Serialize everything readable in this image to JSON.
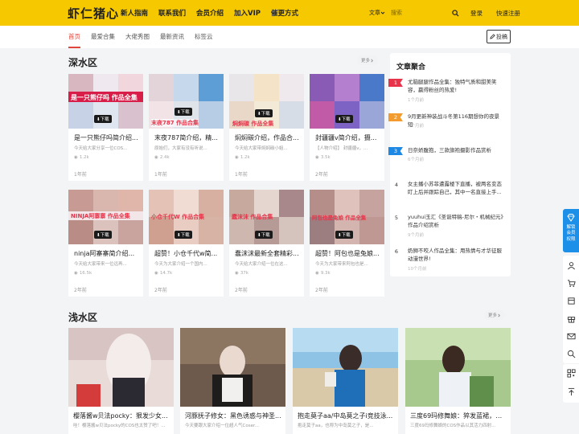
{
  "header": {
    "logo": "虾仁猪心",
    "nav": [
      "新人指南",
      "联系我们",
      "会员介绍",
      "加入VIP",
      "催更方式"
    ],
    "search_type": "文章",
    "search_placeholder": "搜索",
    "login": "登录",
    "register": "快速注册",
    "bar_color": "#f5c800"
  },
  "subnav": {
    "tabs": [
      "首页",
      "最爱合集",
      "大佬秀图",
      "最新资讯",
      "标签云"
    ],
    "active_tab": "首页",
    "post_button": "投稿",
    "accent_color": "#e0463b"
  },
  "deep_section": {
    "title": "深水区",
    "more": "更多",
    "badge_label": "下载",
    "cards": [
      {
        "title": "是一只熊仔吗简介绍...",
        "desc": "今天给大家分享一位COS...",
        "views": "1.2k",
        "time": "1年前",
        "overlay": "是一只熊仔吗 作品全集"
      },
      {
        "title": "末夜787简介绍，精...",
        "desc": "原始们，大家有没有听说...",
        "views": "2.4k",
        "time": "1年前",
        "overlay": "末夜787 作品合集"
      },
      {
        "title": "焖焖碳介绍，作品合...",
        "desc": "今天给大家带焖焖碳小姐...",
        "views": "1.2k",
        "time": "1年前",
        "overlay": "焖焖碳 作品全集"
      },
      {
        "title": "封疆疆v简介绍，摄...",
        "desc": "【人物介绍】 封疆疆v，...",
        "views": "3.5k",
        "time": "2年前",
        "overlay": ""
      },
      {
        "title": "ninja阿寨寨简介绍...",
        "desc": "今天给大家带来一位远再...",
        "views": "16.5k",
        "time": "2年前",
        "overlay": "NINJA阿寨寨 作品全集"
      },
      {
        "title": "超赞！小仓千代w简...",
        "desc": "今天为大家介绍一个国内...",
        "views": "14.7k",
        "time": "2年前",
        "overlay": "小仓千代W 作品合集"
      },
      {
        "title": "蠢沫沫最新全套精彩...",
        "desc": "今天给大家介绍一位在这...",
        "views": "37k",
        "time": "2年前",
        "overlay": "蠢沫沫 作品合集"
      },
      {
        "title": "超赞！阿包也是兔娘...",
        "desc": "今天为大家带来阿包也是...",
        "views": "9.3k",
        "time": "2年前",
        "overlay": "阿包也是兔娘 作品全集"
      }
    ]
  },
  "aggregation": {
    "title": "文章聚合",
    "items": [
      {
        "rank": "1",
        "text": "尤脑腿腿作品全集：独特气质和甜美笑容，赢得粉丝的热爱!",
        "time": "1个月前",
        "color": "#e8344a"
      },
      {
        "rank": "2",
        "text": "9月更新神装战斗冬第116期想你的夜景短",
        "time": "2个月前",
        "color": "#f39b2d"
      },
      {
        "rank": "3",
        "text": "日奈娇腹抱，三款旗袍摄影作品赏析",
        "time": "6个月前",
        "color": "#1e88e5"
      },
      {
        "rank": "4",
        "text": "女主播小苏菲遭露楼下直播，被两名变态盯上后并跟踪自己，其中一名直接上手...",
        "time": "",
        "color": ""
      },
      {
        "rank": "5",
        "text": "yuuhui玉汇《圣诞特稿-尼尔・机械纪元》作品介绍赏析",
        "time": "9个月前",
        "color": ""
      },
      {
        "rank": "6",
        "text": "奶狮不咬人作品全集：用热情与才华征服动漫世界!",
        "time": "10个月前",
        "color": ""
      }
    ]
  },
  "shallow_section": {
    "title": "浅水区",
    "more": "更多",
    "cards": [
      {
        "title": "樱落酱w贝法pocky：狠发少女...",
        "desc": "哇！樱落酱w贝法pocky的COS也太赞了吧！..."
      },
      {
        "title": "河豚抚子修女：黑色诱惑与神圣...",
        "desc": "今天要跟大家介绍一位超人气Coser..."
      },
      {
        "title": "抱走莫子aa/中岛莫之子i竞技泳...",
        "desc": "抱走莫子aa，也称为中岛莫之子，是..."
      },
      {
        "title": "三度69玛修舞娘：猝发蓝裙，活...",
        "desc": "三度69玛修舞娘的COS作品以其活力四射..."
      }
    ]
  },
  "sidebar_float": {
    "vip_label": "解锁会员权限",
    "icons": [
      "user-icon",
      "cart-icon",
      "wallet-icon",
      "gift-icon",
      "mail-icon",
      "search-icon",
      "qrcode-icon",
      "arrow-up-icon"
    ]
  }
}
